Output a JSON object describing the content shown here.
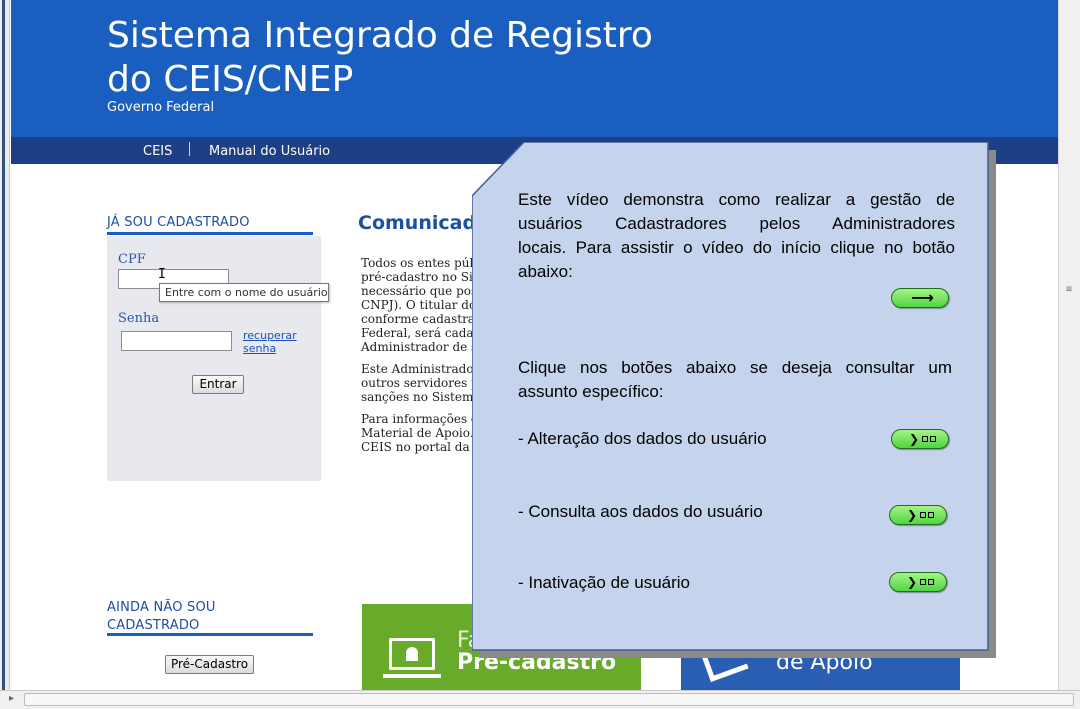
{
  "header": {
    "title_line1": "Sistema Integrado de Registro",
    "title_line2": "do CEIS/CNEP",
    "subtitle": "Governo Federal"
  },
  "nav": {
    "items": [
      {
        "label": "CEIS"
      },
      {
        "label": "Manual do Usuário"
      }
    ]
  },
  "login": {
    "section_title": "JÁ SOU CADASTRADO",
    "cpf_label": "CPF",
    "cpf_tooltip": "Entre com o nome do usuário",
    "password_label": "Senha",
    "recover_line1": "recuperar",
    "recover_line2": "senha",
    "submit_label": "Entrar"
  },
  "signup": {
    "section_title_line1": "AINDA NÃO SOU",
    "section_title_line2": "CADASTRADO",
    "button_label": "Pré-Cadastro"
  },
  "communications": {
    "title": "Comunicad",
    "lines": [
      "Todos os entes púb",
      "pré-cadastro no Sis",
      "necessário que poss",
      "CNPJ). O titular do",
      "conforme cadastrad",
      "Federal, será cadast",
      "Administrador de s",
      "Este Administrador",
      "outros servidores p",
      "sanções no Sistema",
      "Para informações d",
      "Material de Apoio.",
      "CEIS no portal da C"
    ]
  },
  "banners": {
    "green_line1": "Faç",
    "green_line2": "Pré-cadastro",
    "blue_text": "de Apoio"
  },
  "overlay": {
    "intro_lines": [
      "Este vídeo demonstra como realizar a gestão de",
      "usuários Cadastradores pelos Administradores",
      "locais. Para assistir o vídeo do início clique no botão",
      "abaixo:"
    ],
    "topics_lines": [
      "Clique nos botões abaixo se deseja consultar um",
      "assunto específico:"
    ],
    "topics": [
      {
        "label": "- Alteração dos dados do usuário"
      },
      {
        "label": "- Consulta aos dados do usuário"
      },
      {
        "label": "- Inativação de usuário"
      }
    ],
    "colors": {
      "panel_fill": "#c5d4ec",
      "button_green": "#52d443"
    }
  }
}
